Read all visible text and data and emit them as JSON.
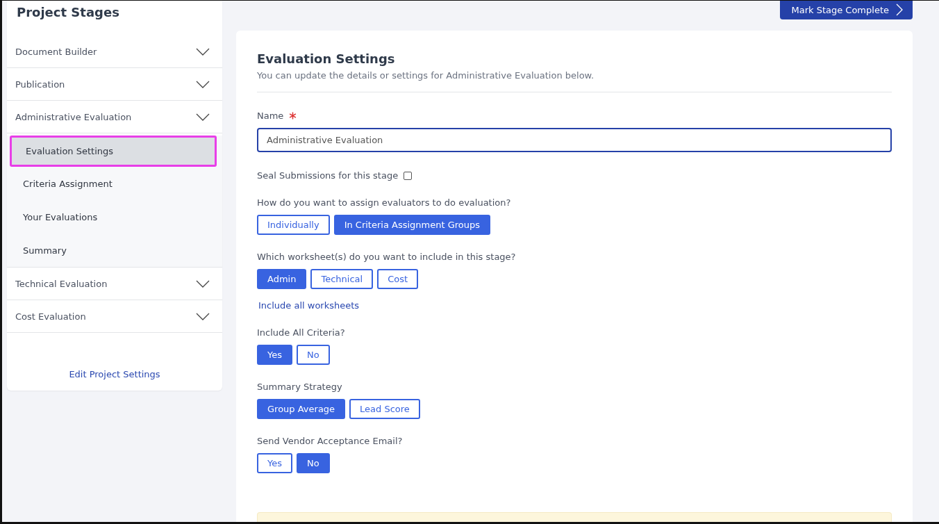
{
  "sidebar": {
    "title": "Project Stages",
    "stages": [
      {
        "label": "Document Builder"
      },
      {
        "label": "Publication"
      },
      {
        "label": "Administrative Evaluation",
        "children": [
          {
            "label": "Evaluation Settings",
            "selected": true
          },
          {
            "label": "Criteria Assignment",
            "selected": false
          },
          {
            "label": "Your Evaluations",
            "selected": false
          },
          {
            "label": "Summary",
            "selected": false
          }
        ]
      },
      {
        "label": "Technical Evaluation"
      },
      {
        "label": "Cost Evaluation"
      }
    ],
    "footer_link": "Edit Project Settings"
  },
  "header": {
    "complete_button": "Mark Stage Complete"
  },
  "form": {
    "title": "Evaluation Settings",
    "subtitle": "You can update the details or settings for Administrative Evaluation below.",
    "name_field": {
      "label": "Name",
      "required": true,
      "value": "Administrative Evaluation"
    },
    "seal": {
      "label": "Seal Submissions for this stage",
      "checked": false
    },
    "questions": [
      {
        "label": "How do you want to assign evaluators to do evaluation?",
        "options": [
          {
            "label": "Individually",
            "selected": false
          },
          {
            "label": "In Criteria Assignment Groups",
            "selected": true
          }
        ]
      },
      {
        "label": "Which worksheet(s) do you want to include in this stage?",
        "options": [
          {
            "label": "Admin",
            "selected": true
          },
          {
            "label": "Technical",
            "selected": false
          },
          {
            "label": "Cost",
            "selected": false
          }
        ],
        "link": "Include all worksheets"
      },
      {
        "label": "Include All Criteria?",
        "options": [
          {
            "label": "Yes",
            "selected": true
          },
          {
            "label": "No",
            "selected": false
          }
        ]
      },
      {
        "label": "Summary Strategy",
        "options": [
          {
            "label": "Group Average",
            "selected": true
          },
          {
            "label": "Lead Score",
            "selected": false
          }
        ]
      },
      {
        "label": "Send Vendor Acceptance Email?",
        "options": [
          {
            "label": "Yes",
            "selected": false
          },
          {
            "label": "No",
            "selected": true
          }
        ]
      }
    ]
  }
}
